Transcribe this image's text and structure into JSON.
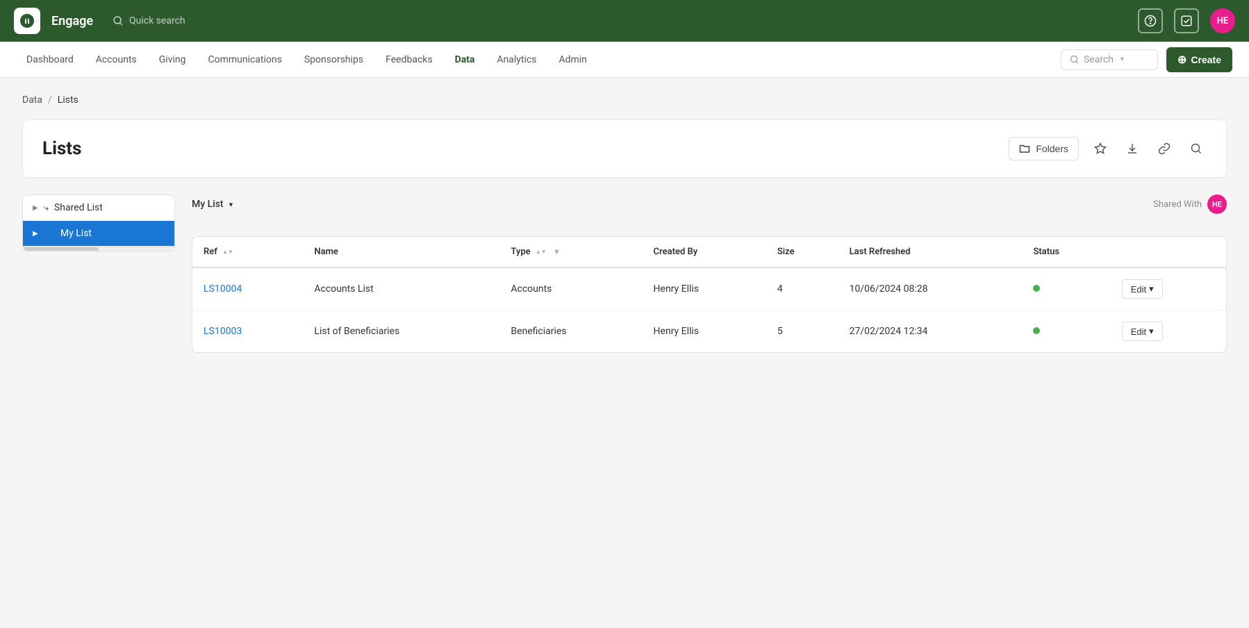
{
  "app": {
    "brand": "Engage",
    "logo_alt": "engage-logo"
  },
  "topbar": {
    "quick_search_placeholder": "Quick search",
    "help_icon": "question-circle-icon",
    "check_icon": "check-square-icon",
    "avatar_initials": "HE",
    "avatar_bg": "#e91e8c"
  },
  "navbar": {
    "items": [
      {
        "label": "Dashboard",
        "active": false
      },
      {
        "label": "Accounts",
        "active": false
      },
      {
        "label": "Giving",
        "active": false
      },
      {
        "label": "Communications",
        "active": false
      },
      {
        "label": "Sponsorships",
        "active": false
      },
      {
        "label": "Feedbacks",
        "active": false
      },
      {
        "label": "Data",
        "active": true
      },
      {
        "label": "Analytics",
        "active": false
      },
      {
        "label": "Admin",
        "active": false
      }
    ],
    "search_placeholder": "Search",
    "create_label": "Create"
  },
  "breadcrumb": {
    "items": [
      "Data",
      "Lists"
    ]
  },
  "page": {
    "title": "Lists",
    "folders_label": "Folders"
  },
  "toolbar": {
    "folders_label": "Folders",
    "star_icon": "star-icon",
    "download_icon": "download-icon",
    "link_icon": "link-icon",
    "search_icon": "search-icon"
  },
  "list_filter": {
    "my_list_label": "My List",
    "shared_with_label": "Shared With",
    "shared_avatar_initials": "HE",
    "shared_avatar_bg": "#e91e8c"
  },
  "sidebar": {
    "items": [
      {
        "ref": "shared-list",
        "label": "Shared List",
        "icon": "share-icon",
        "expanded": false,
        "selected": false
      },
      {
        "ref": "my-list",
        "label": "My List",
        "icon": "user-icon",
        "expanded": false,
        "selected": true
      }
    ]
  },
  "table": {
    "columns": [
      {
        "key": "ref",
        "label": "Ref",
        "sortable": true
      },
      {
        "key": "name",
        "label": "Name",
        "sortable": false
      },
      {
        "key": "type",
        "label": "Type",
        "sortable": true,
        "filterable": true
      },
      {
        "key": "created_by",
        "label": "Created By",
        "sortable": false
      },
      {
        "key": "size",
        "label": "Size",
        "sortable": false
      },
      {
        "key": "last_refreshed",
        "label": "Last Refreshed",
        "sortable": false
      },
      {
        "key": "status",
        "label": "Status",
        "sortable": false
      }
    ],
    "rows": [
      {
        "ref": "LS10004",
        "name": "Accounts List",
        "type": "Accounts",
        "created_by": "Henry Ellis",
        "size": "4",
        "last_refreshed": "10/06/2024 08:28",
        "status": "active",
        "edit_label": "Edit"
      },
      {
        "ref": "LS10003",
        "name": "List of Beneficiaries",
        "type": "Beneficiaries",
        "created_by": "Henry Ellis",
        "size": "5",
        "last_refreshed": "27/02/2024 12:34",
        "status": "active",
        "edit_label": "Edit"
      }
    ]
  }
}
